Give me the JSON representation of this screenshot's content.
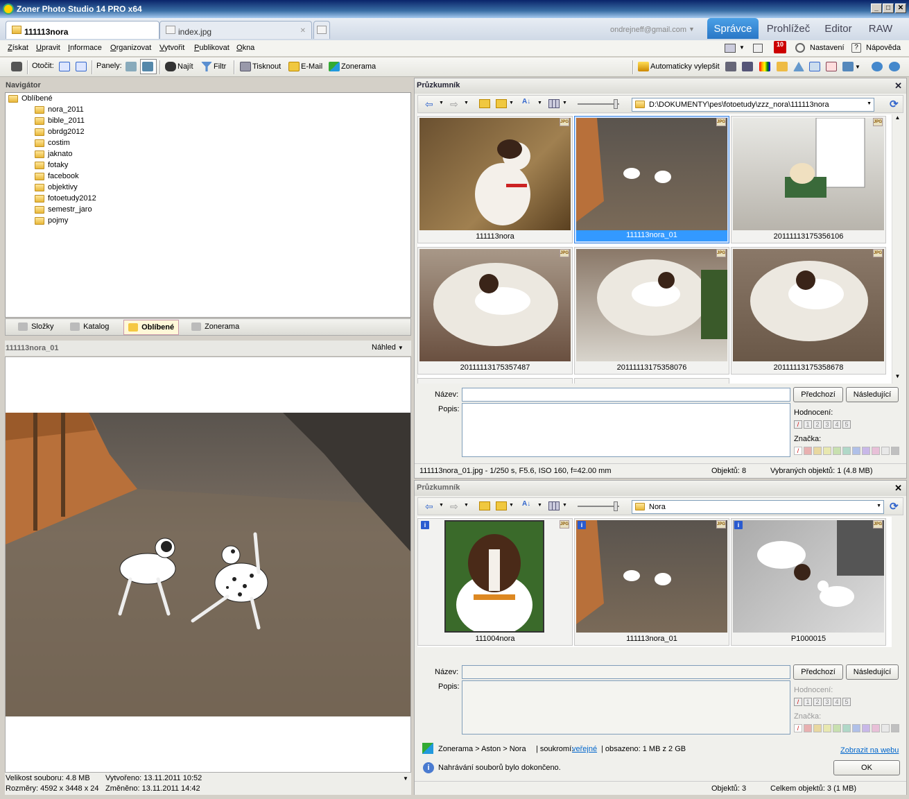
{
  "window": {
    "title": "Zoner Photo Studio 14 PRO x64"
  },
  "tabs": [
    {
      "label": "111113nora"
    },
    {
      "label": "index.jpg"
    }
  ],
  "account": "ondrejneff@gmail.com",
  "modes": [
    "Správce",
    "Prohlížeč",
    "Editor",
    "RAW"
  ],
  "menu": [
    "Získat",
    "Upravit",
    "Informace",
    "Organizovat",
    "Vytvořit",
    "Publikovat",
    "Okna"
  ],
  "menu_right": {
    "badge": "10",
    "settings": "Nastavení",
    "help": "Nápověda"
  },
  "toolbar": {
    "rotate": "Otočit:",
    "panels": "Panely:",
    "find": "Najít",
    "filter": "Filtr",
    "print": "Tisknout",
    "email": "E-Mail",
    "zonerama": "Zonerama",
    "auto": "Automaticky vylepšit"
  },
  "navigator": {
    "title": "Navigátor",
    "root": "Oblíbené",
    "items": [
      "nora_2011",
      "bible_2011",
      "obrdg2012",
      "costim",
      "jaknato",
      "fotaky",
      "facebook",
      "objektivy",
      "fotoetudy2012",
      "semestr_jaro",
      "pojmy"
    ],
    "tabs": [
      "Složky",
      "Katalog",
      "Oblíbené",
      "Zonerama"
    ]
  },
  "preview": {
    "filename": "111113nora_01",
    "mode": "Náhled",
    "size": "Velikost souboru: 4.8 MB",
    "dims": "Rozměry: 4592 x 3448 x 24",
    "created": "Vytvořeno: 13.11.2011 10:52",
    "modified": "Změněno: 13.11.2011 14:42"
  },
  "explorer1": {
    "title": "Průzkumník",
    "path": "D:\\DOKUMENTY\\pes\\fotoetudy\\zzz_nora\\111113nora",
    "thumbs": [
      "111113nora",
      "111113nora_01",
      "20111113175356106",
      "20111113175357487",
      "20111113175358076",
      "20111113175358678"
    ],
    "name_label": "Název:",
    "desc_label": "Popis:",
    "prev": "Předchozí",
    "next": "Následující",
    "rating_label": "Hodnocení:",
    "tag_label": "Značka:",
    "ratings": [
      "1",
      "2",
      "3",
      "4",
      "5"
    ],
    "status_info": "111113nora_01.jpg - 1/250 s, F5.6, ISO 160, f=42.00 mm",
    "status_count": "Objektů: 8",
    "status_selected": "Vybraných objektů: 1 (4.8 MB)"
  },
  "explorer2": {
    "title": "Průzkumník",
    "path": "Nora",
    "thumbs": [
      "111004nora",
      "111113nora_01",
      "P1000015"
    ],
    "name_label": "Název:",
    "desc_label": "Popis:",
    "prev": "Předchozí",
    "next": "Následující",
    "rating_label": "Hodnocení:",
    "tag_label": "Značka:",
    "zonerama_path": "Zonerama > Aston > Nora",
    "privacy_label": "| soukromí:",
    "privacy_value": "veřejné",
    "used": "| obsazeno: 1 MB z 2 GB",
    "web_link": "Zobrazit na webu",
    "upload_msg": "Nahrávání souborů bylo dokončeno.",
    "ok": "OK",
    "status_count": "Objektů: 3",
    "status_total": "Celkem objektů: 3 (1 MB)"
  },
  "colors": {
    "accent": "#2a77c6",
    "selection": "#3399ff"
  },
  "swatches": [
    "#e8b0b0",
    "#e8d8a0",
    "#e8e8b0",
    "#c8e0b0",
    "#b0d8c8",
    "#b0c0e8",
    "#c8b8e8",
    "#e8c0d8",
    "#e8e8e8",
    "#c0c0c0"
  ]
}
